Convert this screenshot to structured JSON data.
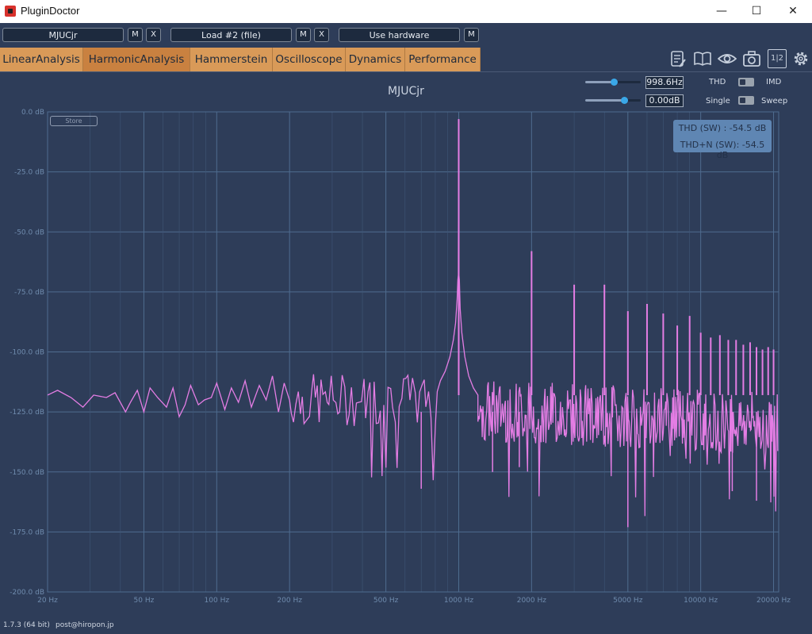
{
  "window": {
    "title": "PluginDoctor",
    "minimize_glyph": "—",
    "maximize_glyph": "☐",
    "close_glyph": "✕"
  },
  "toolbar": {
    "plugin_name": "MJUCjr",
    "plugin_m": "M",
    "plugin_x": "X",
    "load_label": "Load #2 (file)",
    "load_m": "M",
    "load_x": "X",
    "hardware_label": "Use hardware",
    "hardware_m": "M"
  },
  "tabs": [
    {
      "label": "LinearAnalysis"
    },
    {
      "label": "HarmonicAnalysis",
      "active": true
    },
    {
      "label": "Hammerstein"
    },
    {
      "label": "Oscilloscope"
    },
    {
      "label": "Dynamics"
    },
    {
      "label": "Performance"
    }
  ],
  "toolbar_icons": [
    "notes-icon",
    "manual-book-icon",
    "eye-icon",
    "camera-icon",
    "compare-1-2-icon",
    "gear-icon"
  ],
  "compare_label": "1|2",
  "controls": {
    "frequency_value": "998.6Hz",
    "frequency_level": 0.52,
    "gain_value": "0.00dB",
    "gain_level": 0.7,
    "thd_label": "THD",
    "imd_label": "IMD",
    "single_label": "Single",
    "sweep_label": "Sweep"
  },
  "chart": {
    "title": "MJUCjr",
    "store_label": "Store",
    "thd_sw": "THD (SW) : -54.5 dB",
    "thdn_sw": "THD+N (SW): -54.5 dB"
  },
  "chart_data": {
    "type": "line",
    "title": "MJUCjr",
    "xscale": "log",
    "xlim": [
      20,
      21000
    ],
    "ylim": [
      -200,
      0
    ],
    "grid": true,
    "x_ticks": [
      {
        "v": 20,
        "label": "20 Hz"
      },
      {
        "v": 50,
        "label": "50 Hz"
      },
      {
        "v": 100,
        "label": "100 Hz"
      },
      {
        "v": 200,
        "label": "200 Hz"
      },
      {
        "v": 500,
        "label": "500 Hz"
      },
      {
        "v": 1000,
        "label": "1000 Hz"
      },
      {
        "v": 2000,
        "label": "2000 Hz"
      },
      {
        "v": 5000,
        "label": "5000 Hz"
      },
      {
        "v": 10000,
        "label": "10000 Hz"
      },
      {
        "v": 20000,
        "label": "20000 Hz"
      }
    ],
    "y_ticks": [
      {
        "v": 0,
        "label": "0.0 dB"
      },
      {
        "v": -25,
        "label": "-25.0 dB"
      },
      {
        "v": -50,
        "label": "-50.0 dB"
      },
      {
        "v": -75,
        "label": "-75.0 dB"
      },
      {
        "v": -100,
        "label": "-100.0 dB"
      },
      {
        "v": -125,
        "label": "-125.0 dB"
      },
      {
        "v": -150,
        "label": "-150.0 dB"
      },
      {
        "v": -175,
        "label": "-175.0 dB"
      },
      {
        "v": -200,
        "label": "-200.0 dB"
      }
    ],
    "series": [
      {
        "color": "#e47de4",
        "noise_floor_db": -120,
        "fundamental": {
          "freq": 1000,
          "db": -3
        },
        "harmonics": [
          {
            "freq": 2000,
            "db": -58
          },
          {
            "freq": 3000,
            "db": -72
          },
          {
            "freq": 4000,
            "db": -72
          },
          {
            "freq": 5000,
            "db": -83
          },
          {
            "freq": 6000,
            "db": -80
          },
          {
            "freq": 7000,
            "db": -84
          },
          {
            "freq": 8000,
            "db": -89
          },
          {
            "freq": 9000,
            "db": -85
          },
          {
            "freq": 10000,
            "db": -92
          },
          {
            "freq": 11000,
            "db": -94
          },
          {
            "freq": 12000,
            "db": -93
          },
          {
            "freq": 13000,
            "db": -95
          },
          {
            "freq": 14000,
            "db": -95
          },
          {
            "freq": 15000,
            "db": -97
          },
          {
            "freq": 16000,
            "db": -96
          },
          {
            "freq": 17000,
            "db": -98
          },
          {
            "freq": 18000,
            "db": -99
          },
          {
            "freq": 19000,
            "db": -98
          },
          {
            "freq": 20000,
            "db": -99
          }
        ],
        "low_points": [
          [
            20,
            -118
          ],
          [
            22,
            -116
          ],
          [
            25,
            -119
          ],
          [
            28,
            -123
          ],
          [
            31,
            -118
          ],
          [
            35,
            -119
          ],
          [
            38,
            -117
          ],
          [
            42,
            -125
          ],
          [
            44,
            -121
          ],
          [
            47,
            -116
          ],
          [
            50,
            -125
          ],
          [
            53,
            -115
          ],
          [
            57,
            -119
          ],
          [
            62,
            -123
          ],
          [
            66,
            -115
          ],
          [
            70,
            -127
          ],
          [
            74,
            -122
          ],
          [
            78,
            -114
          ],
          [
            84,
            -122
          ],
          [
            89,
            -120
          ],
          [
            95,
            -119
          ],
          [
            100,
            -113
          ],
          [
            108,
            -124
          ],
          [
            115,
            -115
          ],
          [
            123,
            -121
          ],
          [
            131,
            -112
          ],
          [
            139,
            -123
          ],
          [
            150,
            -114
          ],
          [
            160,
            -120
          ],
          [
            170,
            -110
          ],
          [
            180,
            -125
          ],
          [
            190,
            -113
          ]
        ]
      }
    ]
  },
  "status": {
    "version": "1.7.3 (64 bit)",
    "contact": "post@hiropon.jp"
  }
}
